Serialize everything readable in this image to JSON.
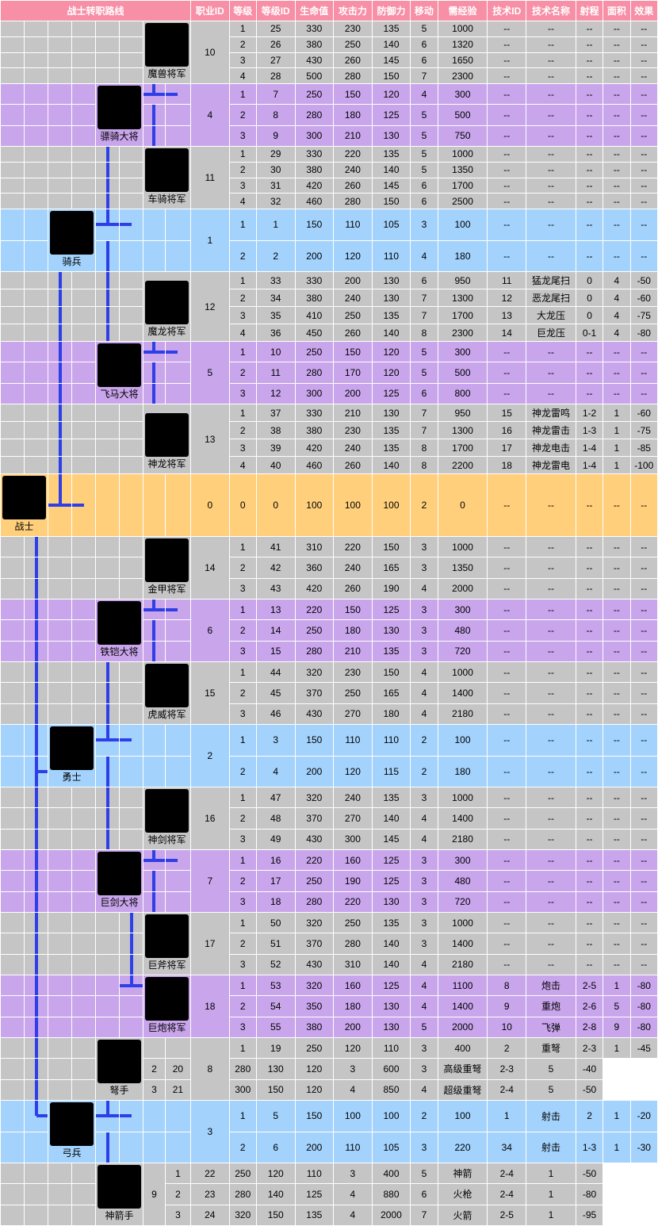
{
  "headers": [
    "战士转职路线",
    "职业ID",
    "等级",
    "等级ID",
    "生命值",
    "攻击力",
    "防御力",
    "移动",
    "需经验",
    "技术ID",
    "技术名称",
    "射程",
    "面积",
    "效果"
  ],
  "units": {
    "root": {
      "name": "战士"
    },
    "u1": {
      "name": "骑兵"
    },
    "u2": {
      "name": "勇士"
    },
    "u3": {
      "name": "弓兵"
    },
    "u4": {
      "name": "骠骑大将"
    },
    "u5": {
      "name": "飞马大将"
    },
    "u6": {
      "name": "铁铠大将"
    },
    "u7": {
      "name": "巨剑大将"
    },
    "u8": {
      "name": "弩手"
    },
    "u10": {
      "name": "魔兽将军"
    },
    "u11": {
      "name": "车骑将军"
    },
    "u12": {
      "name": "魔龙将军"
    },
    "u13": {
      "name": "神龙将军"
    },
    "u14": {
      "name": "金甲将军"
    },
    "u15": {
      "name": "虎威将军"
    },
    "u16": {
      "name": "神剑将军"
    },
    "u17": {
      "name": "巨斧将军"
    },
    "u18": {
      "name": "巨炮将军"
    },
    "u9": {
      "name": "神箭手"
    }
  },
  "rows": [
    {
      "j": 10,
      "lv": 1,
      "lid": 25,
      "hp": 330,
      "atk": 230,
      "def": 135,
      "mv": 5,
      "exp": 1000,
      "tid": "--",
      "tn": "--",
      "rg": "--",
      "ar": "--",
      "ef": "--"
    },
    {
      "j": 10,
      "lv": 2,
      "lid": 26,
      "hp": 380,
      "atk": 250,
      "def": 140,
      "mv": 6,
      "exp": 1320,
      "tid": "--",
      "tn": "--",
      "rg": "--",
      "ar": "--",
      "ef": "--"
    },
    {
      "j": 10,
      "lv": 3,
      "lid": 27,
      "hp": 430,
      "atk": 260,
      "def": 145,
      "mv": 6,
      "exp": 1650,
      "tid": "--",
      "tn": "--",
      "rg": "--",
      "ar": "--",
      "ef": "--"
    },
    {
      "j": 10,
      "lv": 4,
      "lid": 28,
      "hp": 500,
      "atk": 280,
      "def": 150,
      "mv": 7,
      "exp": 2300,
      "tid": "--",
      "tn": "--",
      "rg": "--",
      "ar": "--",
      "ef": "--"
    },
    {
      "j": 4,
      "lv": 1,
      "lid": 7,
      "hp": 250,
      "atk": 150,
      "def": 120,
      "mv": 4,
      "exp": 300,
      "tid": "--",
      "tn": "--",
      "rg": "--",
      "ar": "--",
      "ef": "--"
    },
    {
      "j": 4,
      "lv": 2,
      "lid": 8,
      "hp": 280,
      "atk": 180,
      "def": 125,
      "mv": 5,
      "exp": 500,
      "tid": "--",
      "tn": "--",
      "rg": "--",
      "ar": "--",
      "ef": "--"
    },
    {
      "j": 4,
      "lv": 3,
      "lid": 9,
      "hp": 300,
      "atk": 210,
      "def": 130,
      "mv": 5,
      "exp": 750,
      "tid": "--",
      "tn": "--",
      "rg": "--",
      "ar": "--",
      "ef": "--"
    },
    {
      "j": 11,
      "lv": 1,
      "lid": 29,
      "hp": 330,
      "atk": 220,
      "def": 135,
      "mv": 5,
      "exp": 1000,
      "tid": "--",
      "tn": "--",
      "rg": "--",
      "ar": "--",
      "ef": "--"
    },
    {
      "j": 11,
      "lv": 2,
      "lid": 30,
      "hp": 380,
      "atk": 240,
      "def": 140,
      "mv": 5,
      "exp": 1350,
      "tid": "--",
      "tn": "--",
      "rg": "--",
      "ar": "--",
      "ef": "--"
    },
    {
      "j": 11,
      "lv": 3,
      "lid": 31,
      "hp": 420,
      "atk": 260,
      "def": 145,
      "mv": 6,
      "exp": 1700,
      "tid": "--",
      "tn": "--",
      "rg": "--",
      "ar": "--",
      "ef": "--"
    },
    {
      "j": 11,
      "lv": 4,
      "lid": 32,
      "hp": 460,
      "atk": 280,
      "def": 150,
      "mv": 6,
      "exp": 2500,
      "tid": "--",
      "tn": "--",
      "rg": "--",
      "ar": "--",
      "ef": "--"
    },
    {
      "j": 1,
      "lv": 1,
      "lid": 1,
      "hp": 150,
      "atk": 110,
      "def": 105,
      "mv": 3,
      "exp": 100,
      "tid": "--",
      "tn": "--",
      "rg": "--",
      "ar": "--",
      "ef": "--"
    },
    {
      "j": 1,
      "lv": 2,
      "lid": 2,
      "hp": 200,
      "atk": 120,
      "def": 110,
      "mv": 4,
      "exp": 180,
      "tid": "--",
      "tn": "--",
      "rg": "--",
      "ar": "--",
      "ef": "--"
    },
    {
      "j": 12,
      "lv": 1,
      "lid": 33,
      "hp": 330,
      "atk": 200,
      "def": 130,
      "mv": 6,
      "exp": 950,
      "tid": 11,
      "tn": "猛龙尾扫",
      "rg": "0",
      "ar": 4,
      "ef": -50
    },
    {
      "j": 12,
      "lv": 2,
      "lid": 34,
      "hp": 380,
      "atk": 240,
      "def": 130,
      "mv": 7,
      "exp": 1300,
      "tid": 12,
      "tn": "恶龙尾扫",
      "rg": "0",
      "ar": 4,
      "ef": -60
    },
    {
      "j": 12,
      "lv": 3,
      "lid": 35,
      "hp": 410,
      "atk": 250,
      "def": 135,
      "mv": 7,
      "exp": 1700,
      "tid": 13,
      "tn": "大龙压",
      "rg": "0",
      "ar": 4,
      "ef": -75
    },
    {
      "j": 12,
      "lv": 4,
      "lid": 36,
      "hp": 450,
      "atk": 260,
      "def": 140,
      "mv": 8,
      "exp": 2300,
      "tid": 14,
      "tn": "巨龙压",
      "rg": "0-1",
      "ar": 4,
      "ef": -80
    },
    {
      "j": 5,
      "lv": 1,
      "lid": 10,
      "hp": 250,
      "atk": 150,
      "def": 120,
      "mv": 5,
      "exp": 300,
      "tid": "--",
      "tn": "--",
      "rg": "--",
      "ar": "--",
      "ef": "--"
    },
    {
      "j": 5,
      "lv": 2,
      "lid": 11,
      "hp": 280,
      "atk": 170,
      "def": 120,
      "mv": 5,
      "exp": 500,
      "tid": "--",
      "tn": "--",
      "rg": "--",
      "ar": "--",
      "ef": "--"
    },
    {
      "j": 5,
      "lv": 3,
      "lid": 12,
      "hp": 300,
      "atk": 200,
      "def": 125,
      "mv": 6,
      "exp": 800,
      "tid": "--",
      "tn": "--",
      "rg": "--",
      "ar": "--",
      "ef": "--"
    },
    {
      "j": 13,
      "lv": 1,
      "lid": 37,
      "hp": 330,
      "atk": 210,
      "def": 130,
      "mv": 7,
      "exp": 950,
      "tid": 15,
      "tn": "神龙雷鸣",
      "rg": "1-2",
      "ar": 1,
      "ef": -60
    },
    {
      "j": 13,
      "lv": 2,
      "lid": 38,
      "hp": 380,
      "atk": 230,
      "def": 135,
      "mv": 7,
      "exp": 1300,
      "tid": 16,
      "tn": "神龙雷击",
      "rg": "1-3",
      "ar": 1,
      "ef": -75
    },
    {
      "j": 13,
      "lv": 3,
      "lid": 39,
      "hp": 420,
      "atk": 240,
      "def": 135,
      "mv": 8,
      "exp": 1700,
      "tid": 17,
      "tn": "神龙电击",
      "rg": "1-4",
      "ar": 1,
      "ef": -85
    },
    {
      "j": 13,
      "lv": 4,
      "lid": 40,
      "hp": 460,
      "atk": 260,
      "def": 140,
      "mv": 8,
      "exp": 2200,
      "tid": 18,
      "tn": "神龙雷电",
      "rg": "1-4",
      "ar": 1,
      "ef": -100
    },
    {
      "j": 0,
      "lv": 0,
      "lid": 0,
      "hp": 100,
      "atk": 100,
      "def": 100,
      "mv": 2,
      "exp": 0,
      "tid": "--",
      "tn": "--",
      "rg": "--",
      "ar": "--",
      "ef": "--"
    },
    {
      "j": 14,
      "lv": 1,
      "lid": 41,
      "hp": 310,
      "atk": 220,
      "def": 150,
      "mv": 3,
      "exp": 1000,
      "tid": "--",
      "tn": "--",
      "rg": "--",
      "ar": "--",
      "ef": "--"
    },
    {
      "j": 14,
      "lv": 2,
      "lid": 42,
      "hp": 360,
      "atk": 240,
      "def": 165,
      "mv": 3,
      "exp": 1350,
      "tid": "--",
      "tn": "--",
      "rg": "--",
      "ar": "--",
      "ef": "--"
    },
    {
      "j": 14,
      "lv": 3,
      "lid": 43,
      "hp": 420,
      "atk": 260,
      "def": 190,
      "mv": 4,
      "exp": 2000,
      "tid": "--",
      "tn": "--",
      "rg": "--",
      "ar": "--",
      "ef": "--"
    },
    {
      "j": 6,
      "lv": 1,
      "lid": 13,
      "hp": 220,
      "atk": 150,
      "def": 125,
      "mv": 3,
      "exp": 300,
      "tid": "--",
      "tn": "--",
      "rg": "--",
      "ar": "--",
      "ef": "--"
    },
    {
      "j": 6,
      "lv": 2,
      "lid": 14,
      "hp": 250,
      "atk": 180,
      "def": 130,
      "mv": 3,
      "exp": 480,
      "tid": "--",
      "tn": "--",
      "rg": "--",
      "ar": "--",
      "ef": "--"
    },
    {
      "j": 6,
      "lv": 3,
      "lid": 15,
      "hp": 280,
      "atk": 210,
      "def": 135,
      "mv": 3,
      "exp": 720,
      "tid": "--",
      "tn": "--",
      "rg": "--",
      "ar": "--",
      "ef": "--"
    },
    {
      "j": 15,
      "lv": 1,
      "lid": 44,
      "hp": 320,
      "atk": 230,
      "def": 150,
      "mv": 4,
      "exp": 1000,
      "tid": "--",
      "tn": "--",
      "rg": "--",
      "ar": "--",
      "ef": "--"
    },
    {
      "j": 15,
      "lv": 2,
      "lid": 45,
      "hp": 370,
      "atk": 250,
      "def": 165,
      "mv": 4,
      "exp": 1400,
      "tid": "--",
      "tn": "--",
      "rg": "--",
      "ar": "--",
      "ef": "--"
    },
    {
      "j": 15,
      "lv": 3,
      "lid": 46,
      "hp": 430,
      "atk": 270,
      "def": 180,
      "mv": 4,
      "exp": 2180,
      "tid": "--",
      "tn": "--",
      "rg": "--",
      "ar": "--",
      "ef": "--"
    },
    {
      "j": 2,
      "lv": 1,
      "lid": 3,
      "hp": 150,
      "atk": 110,
      "def": 110,
      "mv": 2,
      "exp": 100,
      "tid": "--",
      "tn": "--",
      "rg": "--",
      "ar": "--",
      "ef": "--"
    },
    {
      "j": 2,
      "lv": 2,
      "lid": 4,
      "hp": 200,
      "atk": 120,
      "def": 115,
      "mv": 2,
      "exp": 180,
      "tid": "--",
      "tn": "--",
      "rg": "--",
      "ar": "--",
      "ef": "--"
    },
    {
      "j": 16,
      "lv": 1,
      "lid": 47,
      "hp": 320,
      "atk": 240,
      "def": 135,
      "mv": 3,
      "exp": 1000,
      "tid": "--",
      "tn": "--",
      "rg": "--",
      "ar": "--",
      "ef": "--"
    },
    {
      "j": 16,
      "lv": 2,
      "lid": 48,
      "hp": 370,
      "atk": 270,
      "def": 140,
      "mv": 4,
      "exp": 1400,
      "tid": "--",
      "tn": "--",
      "rg": "--",
      "ar": "--",
      "ef": "--"
    },
    {
      "j": 16,
      "lv": 3,
      "lid": 49,
      "hp": 430,
      "atk": 300,
      "def": 145,
      "mv": 4,
      "exp": 2180,
      "tid": "--",
      "tn": "--",
      "rg": "--",
      "ar": "--",
      "ef": "--"
    },
    {
      "j": 7,
      "lv": 1,
      "lid": 16,
      "hp": 220,
      "atk": 160,
      "def": 125,
      "mv": 3,
      "exp": 300,
      "tid": "--",
      "tn": "--",
      "rg": "--",
      "ar": "--",
      "ef": "--"
    },
    {
      "j": 7,
      "lv": 2,
      "lid": 17,
      "hp": 250,
      "atk": 190,
      "def": 125,
      "mv": 3,
      "exp": 480,
      "tid": "--",
      "tn": "--",
      "rg": "--",
      "ar": "--",
      "ef": "--"
    },
    {
      "j": 7,
      "lv": 3,
      "lid": 18,
      "hp": 280,
      "atk": 220,
      "def": 130,
      "mv": 3,
      "exp": 720,
      "tid": "--",
      "tn": "--",
      "rg": "--",
      "ar": "--",
      "ef": "--"
    },
    {
      "j": 17,
      "lv": 1,
      "lid": 50,
      "hp": 320,
      "atk": 250,
      "def": 135,
      "mv": 3,
      "exp": 1000,
      "tid": "--",
      "tn": "--",
      "rg": "--",
      "ar": "--",
      "ef": "--"
    },
    {
      "j": 17,
      "lv": 2,
      "lid": 51,
      "hp": 370,
      "atk": 280,
      "def": 140,
      "mv": 3,
      "exp": 1400,
      "tid": "--",
      "tn": "--",
      "rg": "--",
      "ar": "--",
      "ef": "--"
    },
    {
      "j": 17,
      "lv": 3,
      "lid": 52,
      "hp": 430,
      "atk": 310,
      "def": 140,
      "mv": 4,
      "exp": 2180,
      "tid": "--",
      "tn": "--",
      "rg": "--",
      "ar": "--",
      "ef": "--"
    },
    {
      "j": 18,
      "lv": 1,
      "lid": 53,
      "hp": 320,
      "atk": 160,
      "def": 125,
      "mv": 4,
      "exp": 1100,
      "tid": 8,
      "tn": "炮击",
      "rg": "2-5",
      "ar": 1,
      "ef": -80
    },
    {
      "j": 18,
      "lv": 2,
      "lid": 54,
      "hp": 350,
      "atk": 180,
      "def": 130,
      "mv": 4,
      "exp": 1400,
      "tid": 9,
      "tn": "重炮",
      "rg": "2-6",
      "ar": 5,
      "ef": -80
    },
    {
      "j": 18,
      "lv": 3,
      "lid": 55,
      "hp": 380,
      "atk": 200,
      "def": 130,
      "mv": 5,
      "exp": 2000,
      "tid": 10,
      "tn": "飞弹",
      "rg": "2-8",
      "ar": 9,
      "ef": -80
    },
    {
      "j": 8,
      "lv": 1,
      "lid": 19,
      "hp": 250,
      "atk": 120,
      "def": 110,
      "mv": 3,
      "exp": 400,
      "tid": 2,
      "tn": "重弩",
      "rg": "2-3",
      "ar": 1,
      "ef": -45
    },
    {
      "j": 8,
      "lv": 2,
      "lid": 20,
      "hp": 280,
      "atk": 130,
      "def": 120,
      "mv": 3,
      "exp": 600,
      "tid": 3,
      "tn": "高级重弩",
      "rg": "2-3",
      "ar": 5,
      "ef": -40
    },
    {
      "j": 8,
      "lv": 3,
      "lid": 21,
      "hp": 300,
      "atk": 150,
      "def": 120,
      "mv": 4,
      "exp": 850,
      "tid": 4,
      "tn": "超级重弩",
      "rg": "2-4",
      "ar": 5,
      "ef": -50
    },
    {
      "j": 3,
      "lv": 1,
      "lid": 5,
      "hp": 150,
      "atk": 100,
      "def": 100,
      "mv": 2,
      "exp": 100,
      "tid": 1,
      "tn": "射击",
      "rg": "2",
      "ar": 1,
      "ef": -20
    },
    {
      "j": 3,
      "lv": 2,
      "lid": 6,
      "hp": 200,
      "atk": 110,
      "def": 105,
      "mv": 3,
      "exp": 220,
      "tid": 34,
      "tn": "射击",
      "rg": "1-3",
      "ar": 1,
      "ef": -30
    },
    {
      "j": 9,
      "lv": 1,
      "lid": 22,
      "hp": 250,
      "atk": 120,
      "def": 110,
      "mv": 3,
      "exp": 400,
      "tid": 5,
      "tn": "神箭",
      "rg": "2-4",
      "ar": 1,
      "ef": -50
    },
    {
      "j": 9,
      "lv": 2,
      "lid": 23,
      "hp": 280,
      "atk": 140,
      "def": 125,
      "mv": 4,
      "exp": 880,
      "tid": 6,
      "tn": "火枪",
      "rg": "2-4",
      "ar": 1,
      "ef": -80
    },
    {
      "j": 9,
      "lv": 3,
      "lid": 24,
      "hp": 320,
      "atk": 150,
      "def": 135,
      "mv": 4,
      "exp": 2000,
      "tid": 7,
      "tn": "火箭",
      "rg": "2-5",
      "ar": 1,
      "ef": -95
    }
  ]
}
